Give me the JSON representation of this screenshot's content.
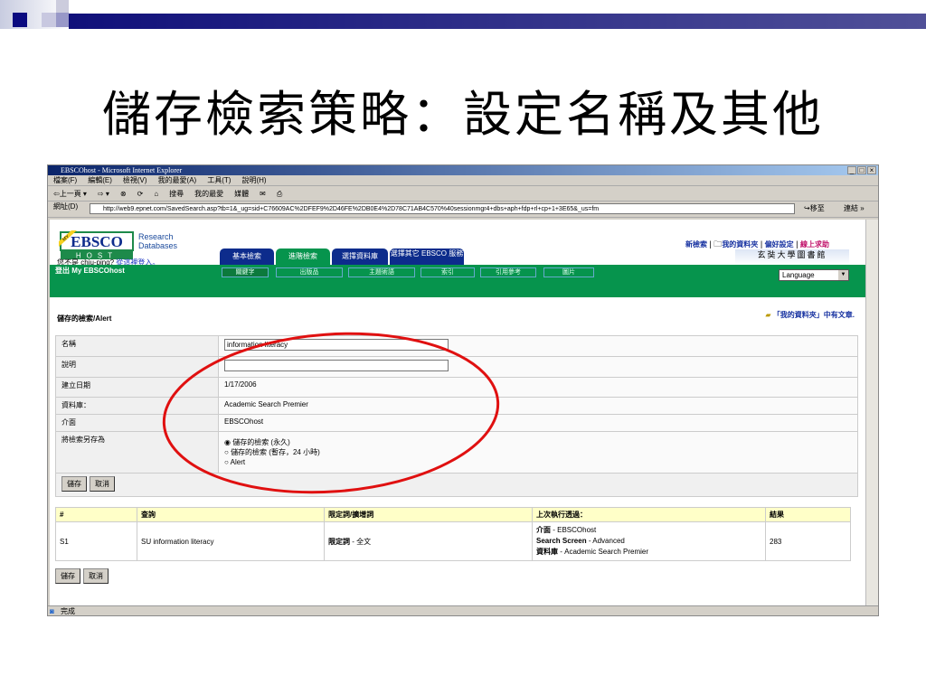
{
  "slide": {
    "title": "儲存檢索策略：設定名稱及其他"
  },
  "browser": {
    "title": "EBSCOhost - Microsoft Internet Explorer",
    "menu": [
      "檔案(F)",
      "編輯(E)",
      "檢視(V)",
      "我的最愛(A)",
      "工具(T)",
      "說明(H)"
    ],
    "toolbar": [
      "⇦上一頁 ▾",
      "⇨ ▾",
      "搜尋",
      "我的最愛",
      "媒體"
    ],
    "address_label": "網址(D)",
    "address": "http://web9.epnet.com/SavedSearch.asp?tb=1&_ug=sid+C76609AC%2DFEF9%2D46FE%2DB0E4%2D78C71AB4C570%40sessionmgr4+dbs+aph+fdp+rl+cp+1+3E65&_us=fm",
    "go": "移至",
    "links": "連結 »",
    "status": "完成"
  },
  "ebsco": {
    "logo_badge": "MY",
    "logo_text": "EBSCO",
    "logo_sub": "HOST",
    "product": [
      "Research",
      "Databases"
    ],
    "not_user": "您不是 chiu-ping?",
    "login_link": "從這裡登入。",
    "logout": "登出 My EBSCOhost",
    "tabs": [
      "基本檢索",
      "進階檢索",
      "選擇資料庫",
      "選擇其它 EBSCO 服務"
    ],
    "subtabs": [
      "關鍵字",
      "出版品",
      "主題術語",
      "索引",
      "引用參考",
      "圖片"
    ],
    "top_links": [
      "新檢索",
      "我的資料夾",
      "偏好設定",
      "線上求助"
    ],
    "library": "玄奘大學圖書館",
    "language": "Language"
  },
  "form": {
    "heading": "儲存的檢索/Alert",
    "folder_note": "「我的資料夾」中有文章.",
    "rows": [
      {
        "label": "名稱",
        "value": "information literacy"
      },
      {
        "label": "說明",
        "value": ""
      },
      {
        "label": "建立日期",
        "value": "1/17/2006"
      },
      {
        "label": "資料庫：",
        "value": "Academic Search Premier"
      },
      {
        "label": "介面",
        "value": "EBSCOhost"
      },
      {
        "label": "將檢索另存為",
        "options": [
          "儲存的檢索 (永久)",
          "儲存的檢索 (暫存，24 小時)",
          "Alert"
        ],
        "selected": 0
      }
    ],
    "save": "儲存",
    "cancel": "取消"
  },
  "results": {
    "headers": [
      "#",
      "查詢",
      "限定詞/擴增詞",
      "上次執行透過：",
      "結果"
    ],
    "row": {
      "num": "S1",
      "query": "SU information literacy",
      "limiter_label": "限定詞",
      "limiter_value": " - 全文",
      "via": [
        {
          "k": "介面",
          "v": " - EBSCOhost"
        },
        {
          "k": "Search Screen",
          "v": " - Advanced"
        },
        {
          "k": "資料庫",
          "v": " - Academic Search Premier"
        }
      ],
      "count": "283"
    }
  },
  "colors": {
    "green": "#06944d",
    "tab": "#0d2c8c",
    "annotation": "#e01010"
  }
}
